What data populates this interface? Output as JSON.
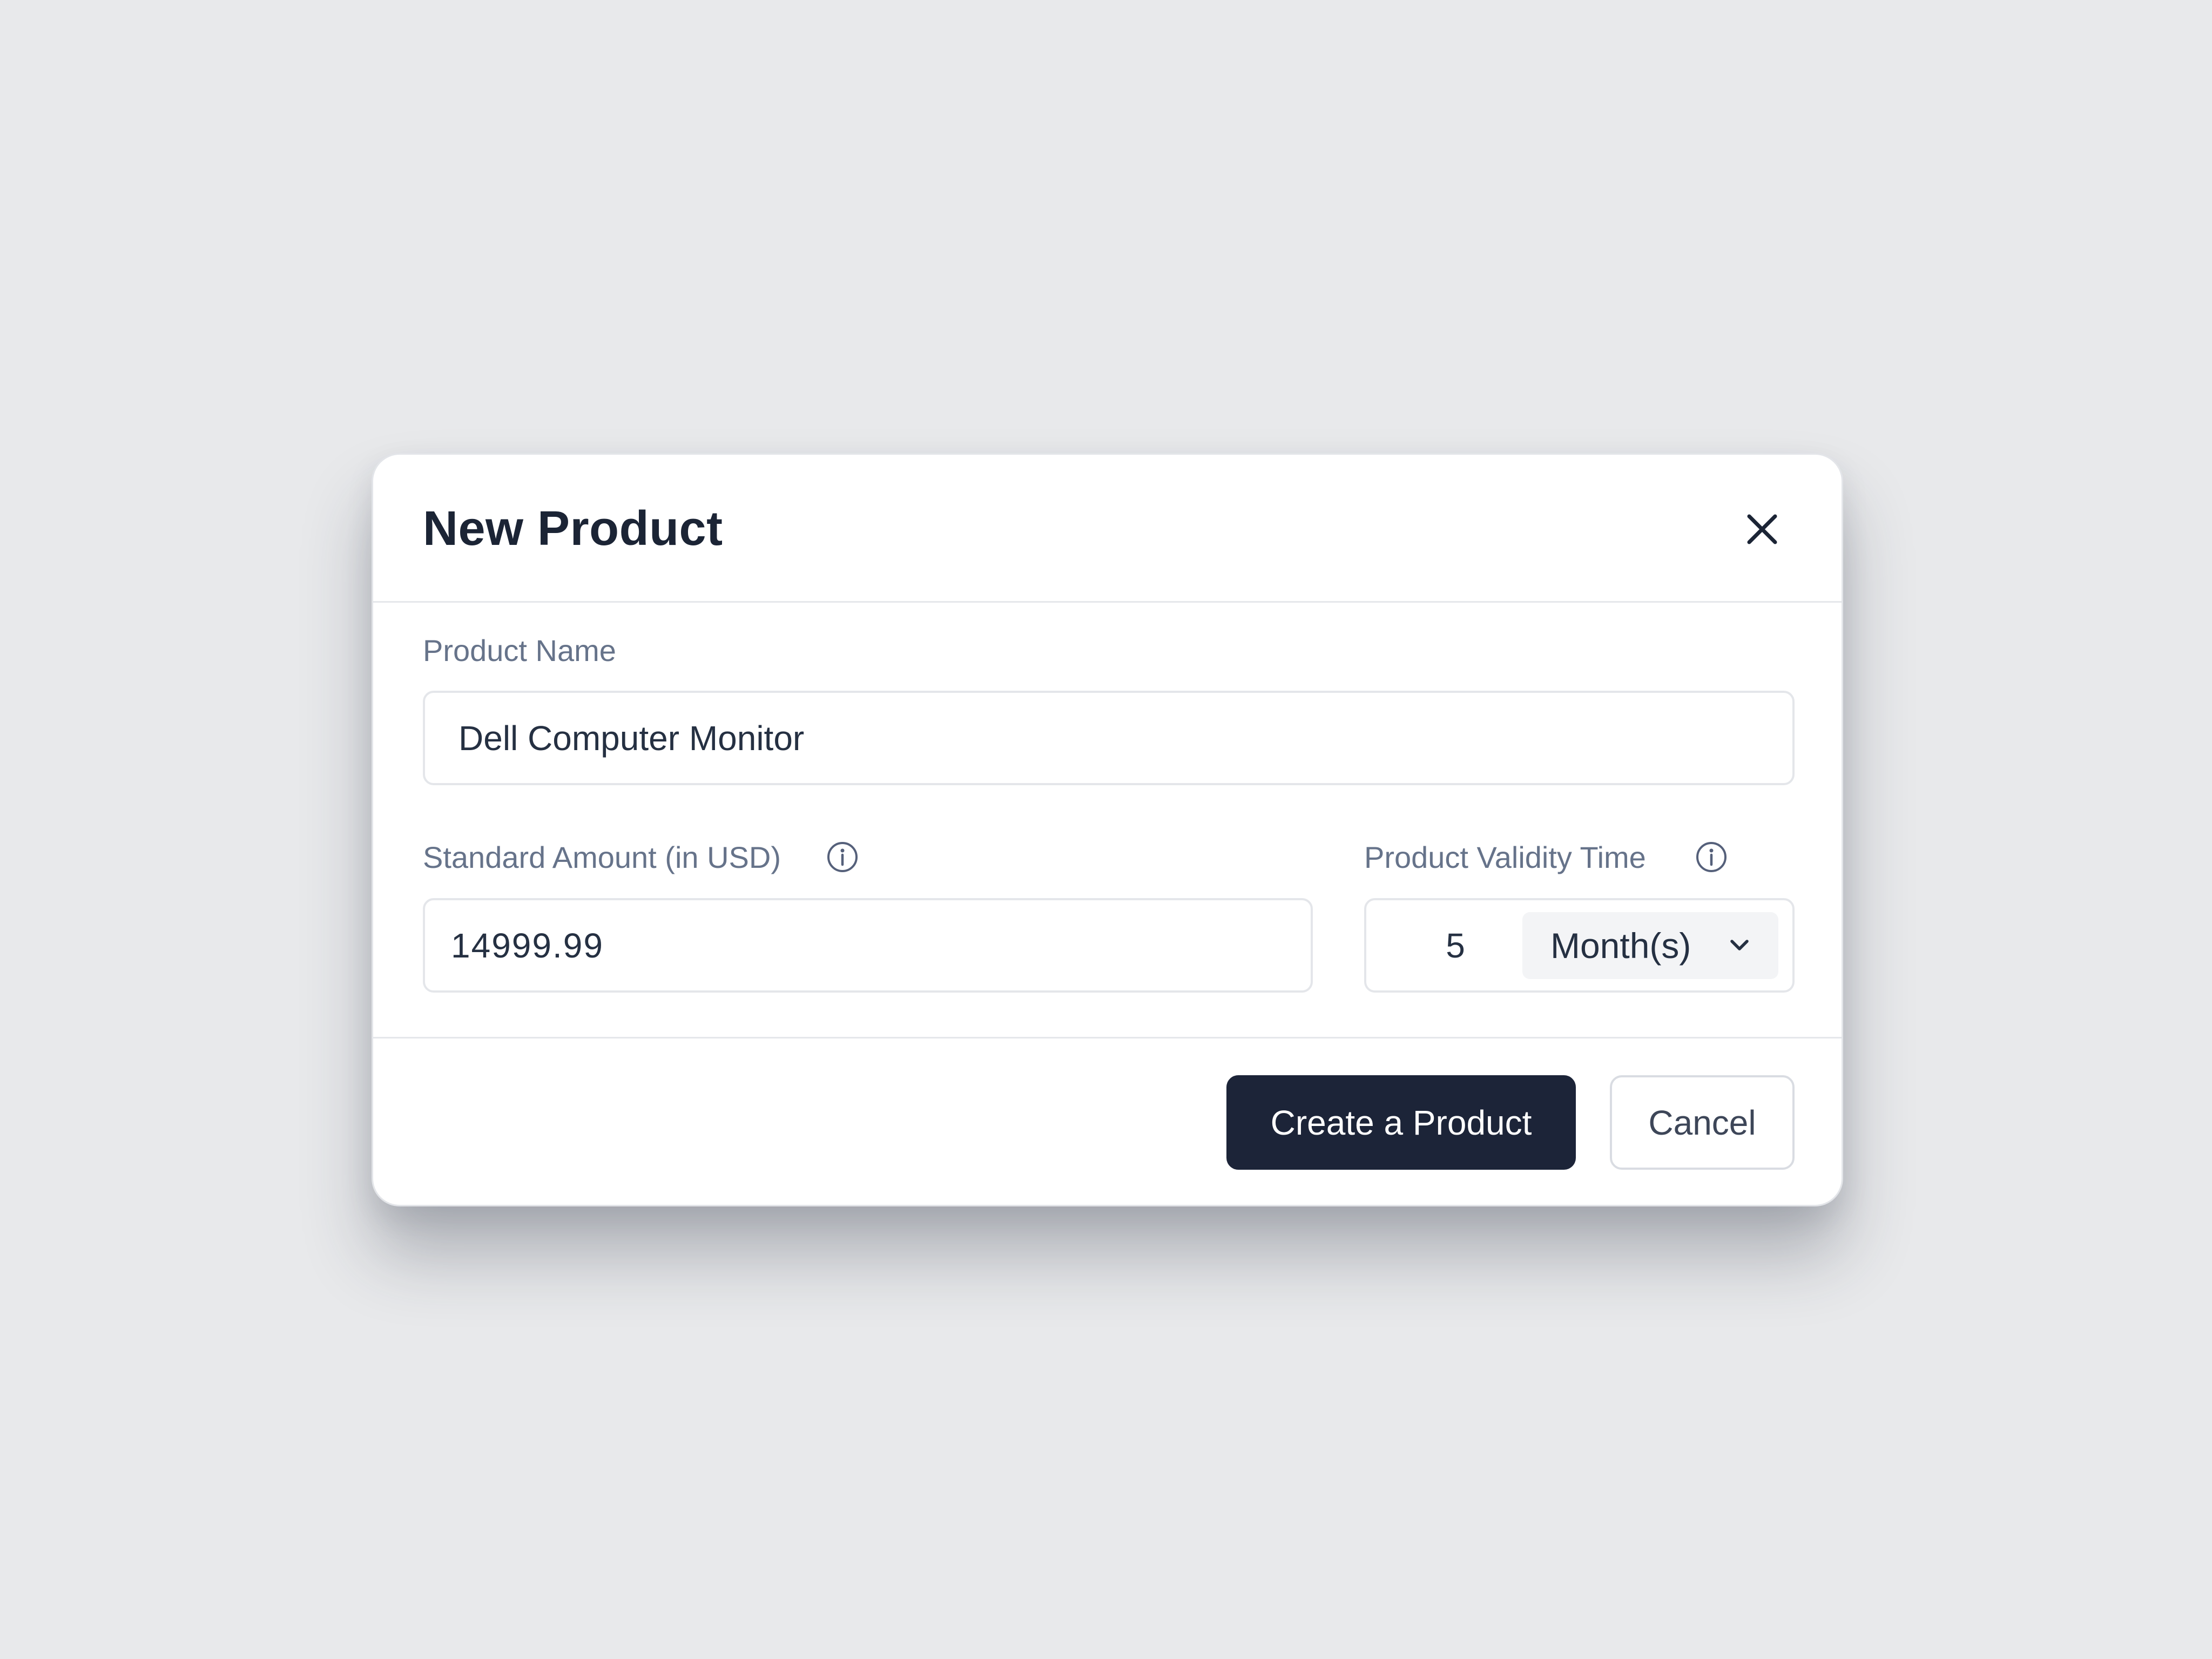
{
  "dialog": {
    "title": "New Product"
  },
  "form": {
    "product_name": {
      "label": "Product Name",
      "value": "Dell Computer Monitor"
    },
    "standard_amount": {
      "label": "Standard Amount (in USD)",
      "value": "14999.99"
    },
    "validity": {
      "label": "Product Validity Time",
      "value": "5",
      "unit": "Month(s)"
    }
  },
  "footer": {
    "create_label": "Create a Product",
    "cancel_label": "Cancel"
  },
  "colors": {
    "primary": "#1c2438",
    "background": "#e8e9eb",
    "label": "#66738a",
    "text": "#253042"
  },
  "icons": {
    "close": "close-icon",
    "info": "info-icon",
    "dropdown": "chevron-down-icon"
  }
}
